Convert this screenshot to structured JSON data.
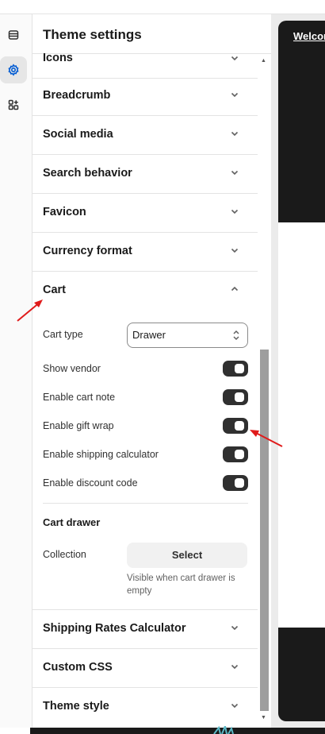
{
  "rail": {
    "items": [
      {
        "icon": "sections-icon",
        "active": false
      },
      {
        "icon": "gear-icon",
        "active": true
      },
      {
        "icon": "apps-icon",
        "active": false
      }
    ]
  },
  "panel": {
    "title": "Theme settings",
    "sections_above": [
      {
        "label": "Icons"
      },
      {
        "label": "Breadcrumb"
      },
      {
        "label": "Social media"
      },
      {
        "label": "Search behavior"
      },
      {
        "label": "Favicon"
      },
      {
        "label": "Currency format"
      }
    ],
    "cart": {
      "label": "Cart",
      "expanded": true,
      "cart_type_label": "Cart type",
      "cart_type_value": "Drawer",
      "toggles": [
        {
          "label": "Show vendor",
          "on": true
        },
        {
          "label": "Enable cart note",
          "on": true
        },
        {
          "label": "Enable gift wrap",
          "on": true
        },
        {
          "label": "Enable shipping calculator",
          "on": true
        },
        {
          "label": "Enable discount code",
          "on": true
        }
      ],
      "drawer_heading": "Cart drawer",
      "collection_label": "Collection",
      "select_button": "Select",
      "collection_hint": "Visible when cart drawer is empty"
    },
    "sections_below": [
      {
        "label": "Shipping Rates Calculator"
      },
      {
        "label": "Custom CSS"
      },
      {
        "label": "Theme style"
      }
    ]
  },
  "preview": {
    "announcement": "Welcome"
  },
  "colors": {
    "toggle_on": "#303030",
    "annotation_arrow": "#e01b1b",
    "active_rail": "#005bd3"
  }
}
